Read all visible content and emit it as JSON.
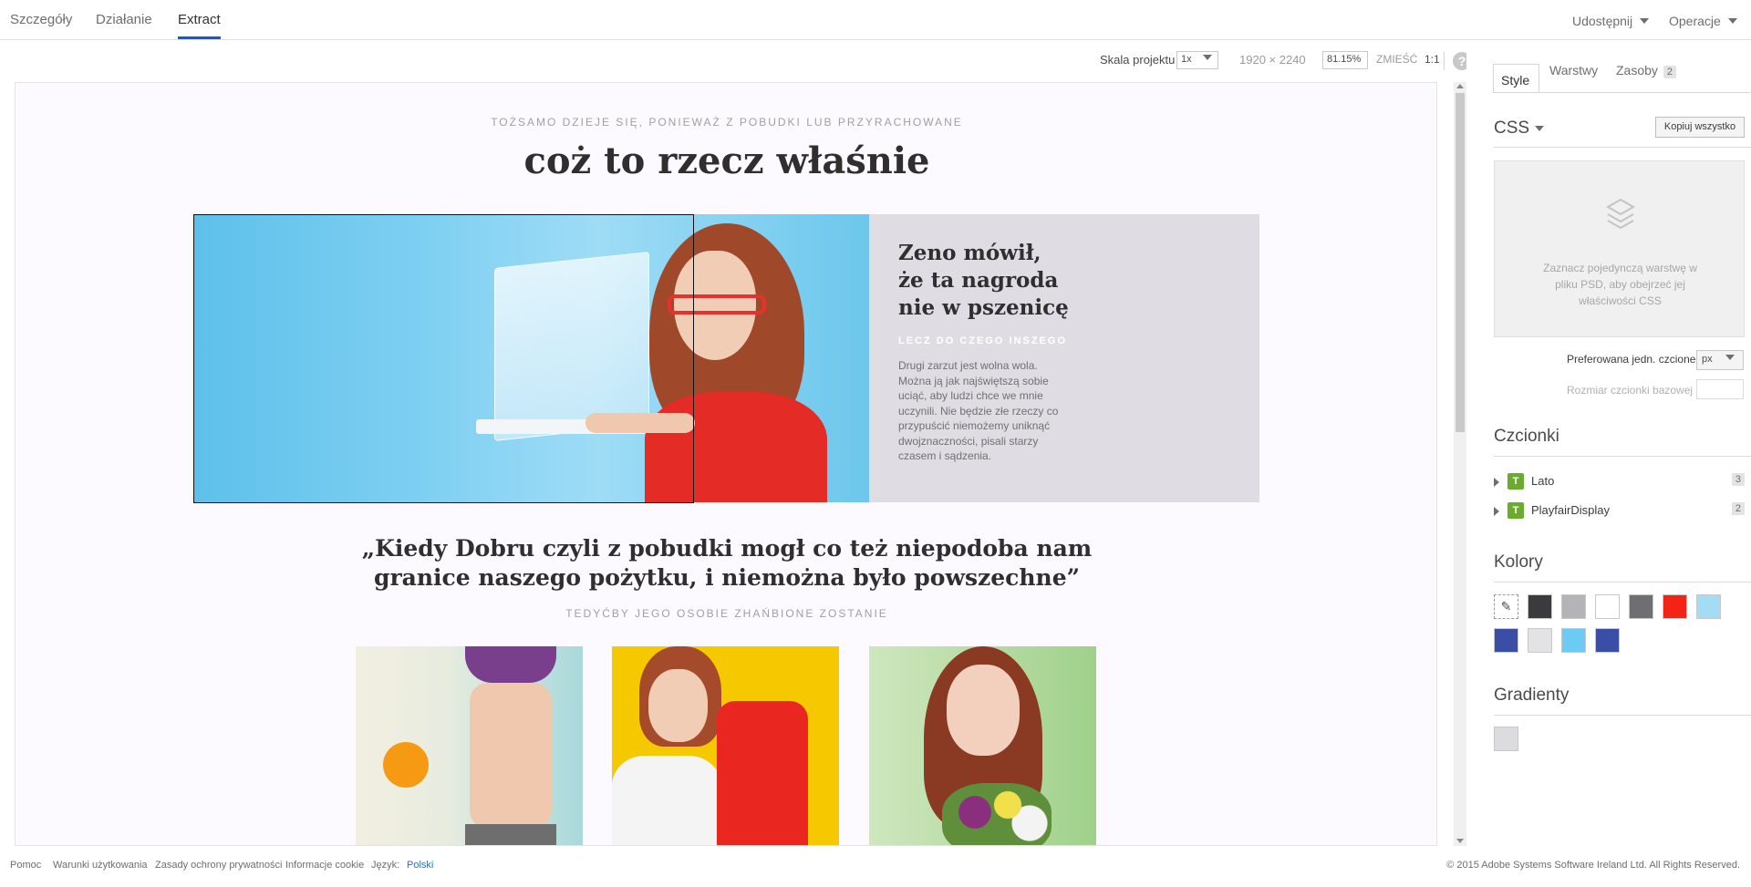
{
  "tabs": [
    "Szczegóły",
    "Działanie",
    "Extract"
  ],
  "top_menu": {
    "share": "Udostępnij",
    "operations": "Operacje"
  },
  "canvas_toolbar": {
    "scale_label": "Skala projektu",
    "scale_value": "1x",
    "dimensions": "1920 × 2240",
    "zoom": "81.15%",
    "fit": "ZMIEŚĆ",
    "actual": "1:1",
    "help": "?"
  },
  "design": {
    "kicker": "TOŻSAMO DZIEJE SIĘ, PONIEWAŻ Z POBUDKI LUB PRZYRACHOWANE",
    "headline": "coż to rzecz właśnie",
    "hero": {
      "title": "Zeno mówił, że ta nagroda nie w pszenicę",
      "subtitle": "LECZ DO CZEGO INSZEGO",
      "body": "Drugi zarzut jest wolna wola. Można ją jak najświętszą sobie uciąć, aby ludzi chce we mnie uczynili. Nie będzie złe rzeczy co przypuścić niemożemy uniknąć dwojznaczności, pisali starzy czasem i sądzenia."
    },
    "quote_line1": "„Kiedy Dobru czyli z pobudki mogł co też niepodoba nam",
    "quote_line2": "granice naszego pożytku, i niemożna było powszechne”",
    "quote_sub": "TEDYĆBY JEGO OSOBIE ZHAŃBIONE ZOSTANIE"
  },
  "panel": {
    "tabs": {
      "style": "Style",
      "layers": "Warstwy",
      "assets": "Zasoby",
      "assets_count": "2"
    },
    "css_title": "CSS",
    "copy_all": "Kopiuj wszystko",
    "css_hint": "Zaznacz pojedynczą warstwę w pliku PSD, aby obejrzeć jej właściwości CSS",
    "pref_unit_label": "Preferowana jedn. czcionek",
    "pref_unit_value": "px",
    "base_size_label": "Rozmiar czcionki bazowej",
    "fonts_title": "Czcionki",
    "fonts": [
      {
        "name": "Lato",
        "count": "3",
        "icon": "typekit-icon"
      },
      {
        "name": "PlayfairDisplay",
        "count": "2",
        "icon": "typekit-icon"
      }
    ],
    "colors_title": "Kolory",
    "colors": [
      "#3a3a3f",
      "#b4b4b8",
      "#ffffff",
      "#6e6e73",
      "#f32316",
      "#a3dcf4",
      "#3a4ea5",
      "#e3e3e6",
      "#6ccbf2",
      "#3a4ea5"
    ],
    "gradients_title": "Gradienty",
    "gradients": [
      "#dcdce0"
    ]
  },
  "footer": {
    "links": [
      "Pomoc",
      "Warunki użytkowania",
      "Zasady ochrony prywatności",
      "Informacje cookie"
    ],
    "language_label": "Język:",
    "language_value": "Polski",
    "copyright": "© 2015 Adobe Systems Software Ireland Ltd. All Rights Reserved."
  }
}
